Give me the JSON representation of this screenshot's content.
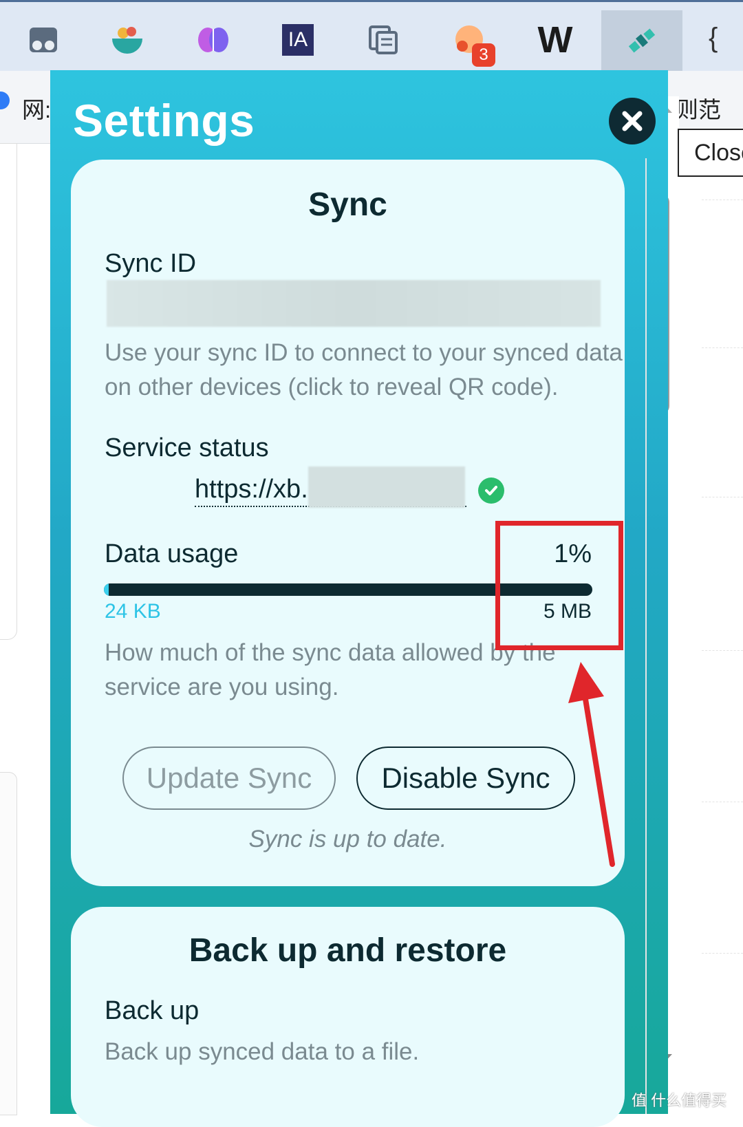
{
  "toolbar": {
    "extensions": [
      {
        "icon": "goggles-icon"
      },
      {
        "icon": "bowl-icon"
      },
      {
        "icon": "brain-icon"
      },
      {
        "icon": "ia-icon",
        "label": "IA"
      },
      {
        "icon": "copy-icon"
      },
      {
        "icon": "chat-bubble-icon",
        "badge": "3"
      },
      {
        "icon": "w-logo-icon",
        "label": "W"
      },
      {
        "icon": "satellite-icon"
      }
    ]
  },
  "bookmarks": {
    "left_text": "网:",
    "right_text": "则范"
  },
  "tooltip": {
    "text": "Close"
  },
  "popup": {
    "title": "Settings",
    "close_icon": "close-icon"
  },
  "sync_card": {
    "heading": "Sync",
    "sync_id_label": "Sync ID",
    "sync_id_desc_line1": "Use your sync ID to connect to your synced data",
    "sync_id_desc_line2": "on other devices (click to reveal QR code).",
    "service_status_label": "Service status",
    "service_url": "https://xb.:",
    "data_usage_label": "Data usage",
    "data_usage_percent": "1%",
    "data_usage_fraction": 0.01,
    "used": "24 KB",
    "limit": "5 MB",
    "usage_desc_line1": "How much of the sync data allowed by the",
    "usage_desc_line2": "service are you using.",
    "update_button": "Update Sync",
    "disable_button": "Disable Sync",
    "status_message": "Sync is up to date."
  },
  "backup_card": {
    "heading": "Back up and restore",
    "backup_label": "Back up",
    "backup_desc": "Back up synced data to a file."
  },
  "colors": {
    "popup_top": "#2ec4df",
    "popup_bottom": "#17a89a",
    "card": "#e9fbfd",
    "dark": "#0d2a31",
    "accent": "#3ad0ee",
    "success": "#2bbd6c",
    "annotation": "#e0262b"
  },
  "watermark": "值 什么值得买"
}
